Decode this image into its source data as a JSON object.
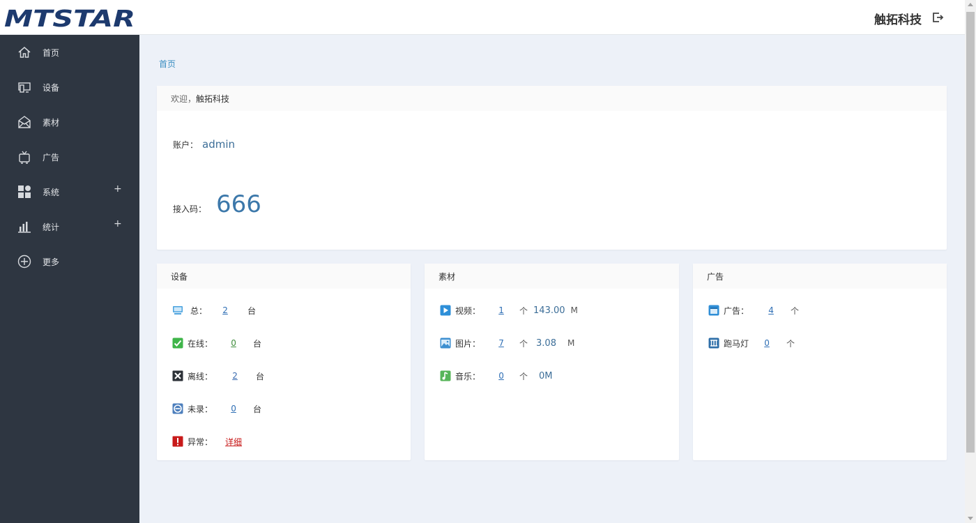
{
  "header": {
    "logo_text": "MTSTAR",
    "company": "触拓科技"
  },
  "sidebar": {
    "items": [
      {
        "label": "首页",
        "icon": "home-icon"
      },
      {
        "label": "设备",
        "icon": "device-icon"
      },
      {
        "label": "素材",
        "icon": "material-icon"
      },
      {
        "label": "广告",
        "icon": "tv-icon"
      },
      {
        "label": "系统",
        "icon": "grid-icon",
        "expand": "+"
      },
      {
        "label": "统计",
        "icon": "bar-chart-icon",
        "expand": "+"
      },
      {
        "label": "更多",
        "icon": "plus-circle-icon"
      }
    ]
  },
  "breadcrumb": "首页",
  "welcome": {
    "greeting": "欢迎，",
    "name": "触拓科技",
    "account_label": "账户：",
    "account": "admin",
    "code_label": "接入码：",
    "code": "666"
  },
  "devices": {
    "title": "设备",
    "total_label": "总：",
    "total": "2",
    "total_unit": "台",
    "online_label": "在线：",
    "online": "0",
    "online_unit": "台",
    "offline_label": "离线：",
    "offline": "2",
    "offline_unit": "台",
    "unregistered_label": "未录：",
    "unregistered": "0",
    "unregistered_unit": "台",
    "abnormal_label": "异常：",
    "abnormal_link": "详细"
  },
  "materials": {
    "title": "素材",
    "video_label": "视频：",
    "video_count": "1",
    "video_unit": "个",
    "video_size": "143.00",
    "video_size_unit": "M",
    "image_label": "图片：",
    "image_count": "7",
    "image_unit": "个",
    "image_size": "3.08",
    "image_size_unit": "M",
    "music_label": "音乐：",
    "music_count": "0",
    "music_unit": "个",
    "music_size": "0M"
  },
  "ads": {
    "title": "广告",
    "ad_label": "广告：",
    "ad_count": "4",
    "ad_unit": "个",
    "marquee_label": "跑马灯",
    "marquee_count": "0",
    "marquee_unit": "个"
  },
  "colors": {
    "sidebar_bg": "#2e3641",
    "content_bg": "#edf1f8",
    "link_blue": "#2f6fb5",
    "danger": "#c81a1a"
  }
}
